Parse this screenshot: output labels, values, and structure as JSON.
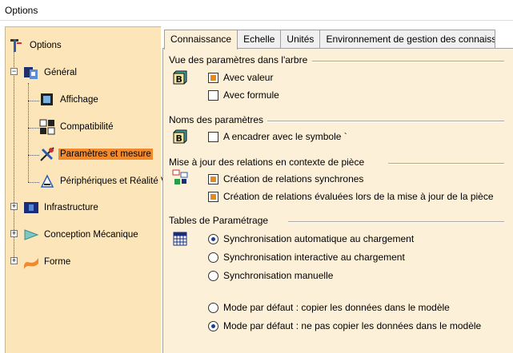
{
  "window": {
    "title": "Options"
  },
  "tree": {
    "items": [
      {
        "label": "Options",
        "icon": "options-root-icon"
      },
      {
        "label": "Général",
        "icon": "general-icon"
      },
      {
        "label": "Affichage",
        "icon": "display-icon"
      },
      {
        "label": "Compatibilité",
        "icon": "compatibility-icon"
      },
      {
        "label": "Paramètres et mesure",
        "icon": "parameters-measure-icon",
        "selected": true
      },
      {
        "label": "Périphériques et Réalité Virtuelle",
        "icon": "devices-vr-icon"
      },
      {
        "label": "Infrastructure",
        "icon": "infrastructure-icon"
      },
      {
        "label": "Conception Mécanique",
        "icon": "mechanical-design-icon"
      },
      {
        "label": "Forme",
        "icon": "shape-icon"
      }
    ],
    "expanders": {
      "collapsed": "+",
      "expanded": "−"
    }
  },
  "tabs": [
    {
      "label": "Connaissance",
      "active": true
    },
    {
      "label": "Echelle"
    },
    {
      "label": "Unités"
    },
    {
      "label": "Environnement de gestion des connaissances"
    }
  ],
  "sections": {
    "tree_params": {
      "title": "Vue des paramètres dans l'arbre",
      "options": [
        {
          "label": "Avec valeur",
          "checked": true
        },
        {
          "label": "Avec formule",
          "checked": false
        }
      ]
    },
    "param_names": {
      "title": "Noms des paramètres",
      "options": [
        {
          "label": "A encadrer avec le symbole `",
          "checked": false
        }
      ]
    },
    "relations_update": {
      "title": "Mise à jour des relations en contexte de pièce",
      "options": [
        {
          "label": "Création de relations synchrones",
          "checked": true
        },
        {
          "label": "Création de relations évaluées lors de la mise à jour de la pièce",
          "checked": true
        }
      ]
    },
    "param_tables": {
      "title": "Tables de Paramétrage",
      "sync_options": [
        {
          "label": "Synchronisation automatique au chargement",
          "selected": true
        },
        {
          "label": "Synchronisation interactive au chargement",
          "selected": false
        },
        {
          "label": "Synchronisation manuelle",
          "selected": false
        }
      ],
      "copy_options": [
        {
          "label": "Mode par défaut : copier les données dans le modèle",
          "selected": false
        },
        {
          "label": "Mode par défaut : ne pas copier les données dans le modèle",
          "selected": true
        }
      ]
    }
  },
  "colors": {
    "tree_background": "#fce6b9",
    "panel_background": "#fdf0d8",
    "selection": "#f08a2c",
    "check_fill": "#e58a1e",
    "radio_fill": "#1a3f8c"
  }
}
